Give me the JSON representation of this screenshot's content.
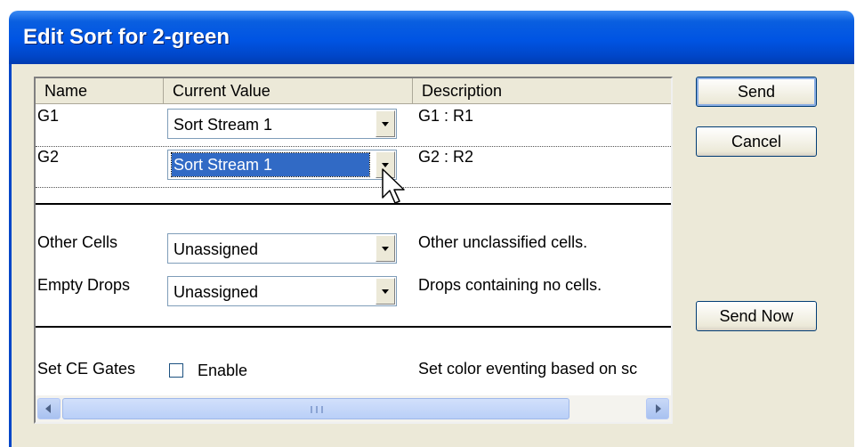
{
  "window": {
    "title": "Edit Sort for 2-green"
  },
  "table": {
    "columns": [
      "Name",
      "Current Value",
      "Description"
    ],
    "gate_rows": [
      {
        "name": "G1",
        "value": "Sort Stream 1",
        "description": "G1 : R1",
        "selected": false
      },
      {
        "name": "G2",
        "value": "Sort Stream 1",
        "description": "G2 : R2",
        "selected": true
      }
    ],
    "other_rows": [
      {
        "name": "Other Cells",
        "value": "Unassigned",
        "description": "Other unclassified cells."
      },
      {
        "name": "Empty Drops",
        "value": "Unassigned",
        "description": "Drops containing no cells."
      }
    ],
    "ce_row": {
      "name": "Set CE Gates",
      "checkbox_label": "Enable",
      "checked": false,
      "description": "Set color eventing based on sc"
    }
  },
  "buttons": {
    "send": "Send",
    "cancel": "Cancel",
    "send_now": "Send Now"
  },
  "colors": {
    "titlebar": "#0054e3",
    "selection": "#316ac5",
    "dialog_bg": "#ece9d8"
  }
}
